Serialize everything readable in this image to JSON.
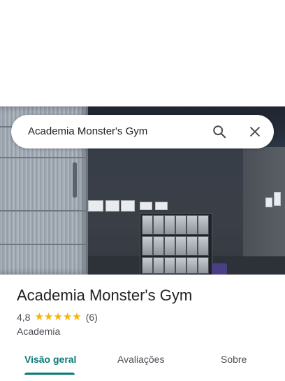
{
  "search": {
    "query": "Academia Monster's Gym",
    "search_icon": "search-icon",
    "close_icon": "close-icon"
  },
  "place": {
    "name": "Academia Monster's Gym",
    "rating": "4,8",
    "stars": 5,
    "review_count": "(6)",
    "category": "Academia"
  },
  "tabs": [
    {
      "label": "Visão geral",
      "active": true
    },
    {
      "label": "Avaliações",
      "active": false
    },
    {
      "label": "Sobre",
      "active": false
    }
  ],
  "colors": {
    "accent": "#0b7a75",
    "star": "#f4b400",
    "text": "#202124",
    "secondary_text": "#4b4f54"
  }
}
